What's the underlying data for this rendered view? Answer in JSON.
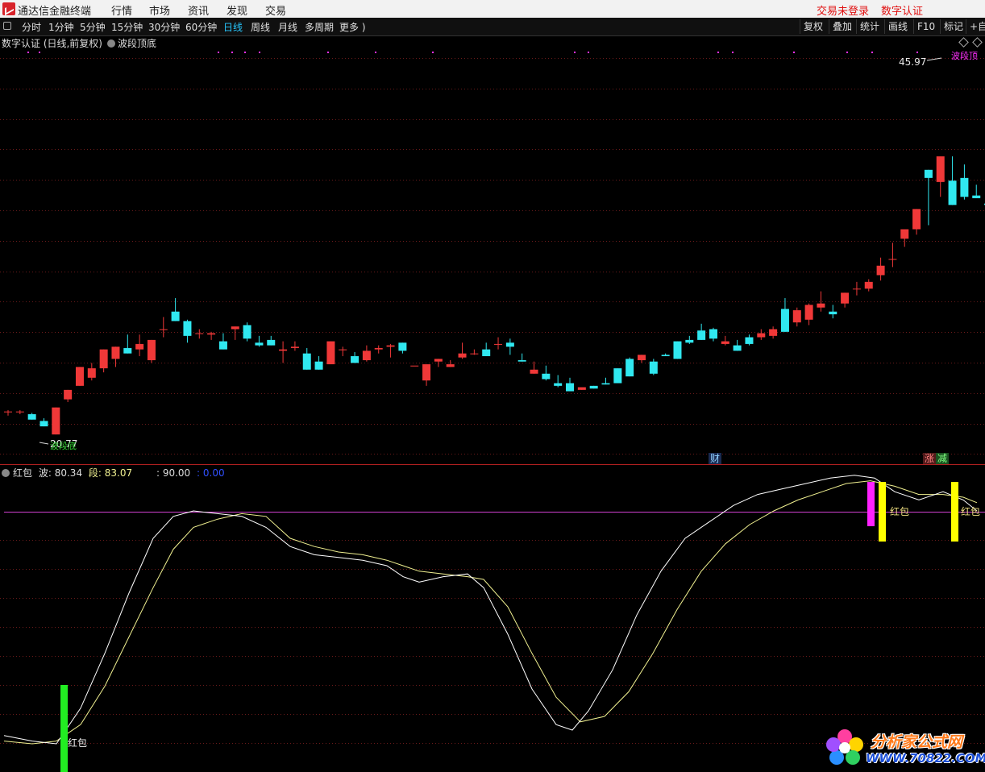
{
  "titlebar": {
    "app_name": "通达信金融终端",
    "menus": [
      "行情",
      "市场",
      "资讯",
      "发现",
      "交易"
    ],
    "right": [
      "交易未登录",
      "数字认证"
    ]
  },
  "toolbar": {
    "periods": [
      "分时",
      "1分钟",
      "5分钟",
      "15分钟",
      "30分钟",
      "60分钟",
      "日线",
      "周线",
      "月线",
      "多周期",
      "更多 )"
    ],
    "active": "日线",
    "right_buttons": [
      "复权",
      "叠加",
      "统计",
      "画线",
      "F10",
      "标记",
      "+自"
    ]
  },
  "main_header": {
    "title": "数字认证 (日线,前复权)",
    "indicator": "波段顶底"
  },
  "annotations": {
    "high_price": "45.97",
    "low_price": "20.77",
    "low_label": "波段底",
    "high_label": "波段顶",
    "event_cai": "财",
    "event_zhang": "涨",
    "event_jian": "减"
  },
  "sub_header": {
    "name": "红包",
    "wave_label": "波:",
    "wave_value": "80.34",
    "seg_label": "段:",
    "seg_value": "83.07",
    "level_label": ": 90.00",
    "level2": ": 0.00"
  },
  "sub_labels": {
    "red_packet_1": "红包",
    "red_packet_2": "红包",
    "red_packet_3": "红包"
  },
  "watermark": {
    "name": "分析家公式网",
    "url": "WWW.70822.COM"
  },
  "colors": {
    "up": "#f03838",
    "down": "#30e8f0",
    "wave": "#ffffff",
    "segment": "#f0f090",
    "level_line": "#d040d0",
    "bar_green": "#22ee22",
    "bar_magenta": "#ff22ff",
    "bar_yellow": "#ffff00",
    "active_tab": "#27c8ff"
  },
  "chart_data": {
    "type": "candlestick",
    "price_range": [
      18.8,
      49.6
    ],
    "candles": [
      [
        22.7,
        22.8,
        22.4,
        22.7
      ],
      [
        22.7,
        22.8,
        22.5,
        22.7
      ],
      [
        22.5,
        22.6,
        22.1,
        22.1
      ],
      [
        22.0,
        22.2,
        21.6,
        21.6
      ],
      [
        21.0,
        23.0,
        21.0,
        23.0
      ],
      [
        23.6,
        24.3,
        23.4,
        24.3
      ],
      [
        24.6,
        26.0,
        24.6,
        26.0
      ],
      [
        25.2,
        26.3,
        25.0,
        25.9
      ],
      [
        25.9,
        27.3,
        25.6,
        27.3
      ],
      [
        26.6,
        27.5,
        26.0,
        27.5
      ],
      [
        27.4,
        28.4,
        27.0,
        27.0
      ],
      [
        27.3,
        28.4,
        26.8,
        27.7
      ],
      [
        26.5,
        28.0,
        26.3,
        28.0
      ],
      [
        28.8,
        29.7,
        28.2,
        28.8
      ],
      [
        30.1,
        31.1,
        29.4,
        29.4
      ],
      [
        29.4,
        29.5,
        27.8,
        28.3
      ],
      [
        28.5,
        28.8,
        28.1,
        28.5
      ],
      [
        28.4,
        28.6,
        28.0,
        28.5
      ],
      [
        27.9,
        28.5,
        27.3,
        27.3
      ],
      [
        28.8,
        29.0,
        28.0,
        29.0
      ],
      [
        29.1,
        29.3,
        27.9,
        28.1
      ],
      [
        27.8,
        28.3,
        27.5,
        27.6
      ],
      [
        28.0,
        28.3,
        27.6,
        27.6
      ],
      [
        27.2,
        27.9,
        26.3,
        27.3
      ],
      [
        27.4,
        27.9,
        27.2,
        27.5
      ],
      [
        27.0,
        27.4,
        25.8,
        25.8
      ],
      [
        26.4,
        26.8,
        25.8,
        25.8
      ],
      [
        26.2,
        27.7,
        26.2,
        27.9
      ],
      [
        27.3,
        27.5,
        26.8,
        27.3
      ],
      [
        26.8,
        27.1,
        26.3,
        26.3
      ],
      [
        26.5,
        27.6,
        26.4,
        27.2
      ],
      [
        27.3,
        27.6,
        27.0,
        27.4
      ],
      [
        27.5,
        27.7,
        26.7,
        27.6
      ],
      [
        27.8,
        27.8,
        27.0,
        27.2
      ],
      [
        26.1,
        26.1,
        26.2,
        26.1
      ],
      [
        25.0,
        26.2,
        24.6,
        26.2
      ],
      [
        26.4,
        26.6,
        26.0,
        26.6
      ],
      [
        26.0,
        26.5,
        26.2,
        26.2
      ],
      [
        26.7,
        27.8,
        26.6,
        27.0
      ],
      [
        27.0,
        27.3,
        26.9,
        27.0
      ],
      [
        27.3,
        27.8,
        26.8,
        26.8
      ],
      [
        27.7,
        28.2,
        27.3,
        27.7
      ],
      [
        27.8,
        28.1,
        26.9,
        27.5
      ],
      [
        26.5,
        27.0,
        26.6,
        26.4
      ],
      [
        25.5,
        26.4,
        25.5,
        25.8
      ],
      [
        25.5,
        26.1,
        25.0,
        25.1
      ],
      [
        24.8,
        25.4,
        24.5,
        24.6
      ],
      [
        24.8,
        25.2,
        24.2,
        24.2
      ],
      [
        24.3,
        24.5,
        24.3,
        24.5
      ],
      [
        24.6,
        24.6,
        24.4,
        24.4
      ],
      [
        24.8,
        25.2,
        24.7,
        24.7
      ],
      [
        25.9,
        25.9,
        24.8,
        24.8
      ],
      [
        26.6,
        26.7,
        25.8,
        25.3
      ],
      [
        26.5,
        26.9,
        26.3,
        26.9
      ],
      [
        26.4,
        26.6,
        25.4,
        25.5
      ],
      [
        26.9,
        27.0,
        26.8,
        26.8
      ],
      [
        27.9,
        27.9,
        26.6,
        26.6
      ],
      [
        28.0,
        28.3,
        27.7,
        27.8
      ],
      [
        28.7,
        29.2,
        28.2,
        28.0
      ],
      [
        28.8,
        28.9,
        27.9,
        28.1
      ],
      [
        27.7,
        28.3,
        27.6,
        27.9
      ],
      [
        27.6,
        28.0,
        27.2,
        27.2
      ],
      [
        28.2,
        28.4,
        27.6,
        27.7
      ],
      [
        28.2,
        28.8,
        28.0,
        28.5
      ],
      [
        28.3,
        29.0,
        28.1,
        28.8
      ],
      [
        30.3,
        31.1,
        28.6,
        28.6
      ],
      [
        29.3,
        30.4,
        29.0,
        30.2
      ],
      [
        29.5,
        30.7,
        29.1,
        30.6
      ],
      [
        30.4,
        31.6,
        30.1,
        30.7
      ],
      [
        30.1,
        30.6,
        29.6,
        29.9
      ],
      [
        30.7,
        31.5,
        30.4,
        31.5
      ],
      [
        31.8,
        32.3,
        31.3,
        31.8
      ],
      [
        31.8,
        32.5,
        31.6,
        32.3
      ],
      [
        32.8,
        34.1,
        32.4,
        33.5
      ],
      [
        34.0,
        35.2,
        33.4,
        34.0
      ],
      [
        35.5,
        36.2,
        34.9,
        36.2
      ],
      [
        36.2,
        37.4,
        35.8,
        37.7
      ],
      [
        40.6,
        40.6,
        36.5,
        40.0
      ],
      [
        39.7,
        40.3,
        38.6,
        41.6
      ],
      [
        39.8,
        41.6,
        38.0,
        38.0
      ],
      [
        40.0,
        41.0,
        38.4,
        38.6
      ],
      [
        38.7,
        39.5,
        38.6,
        38.5
      ],
      [
        38.1,
        39.4,
        38.3,
        38.0
      ],
      [
        39.0,
        39.5,
        38.6,
        38.6
      ],
      [
        39.2,
        41.3,
        38.3,
        41.4
      ],
      [
        44.5,
        46.0,
        42.7,
        43.7
      ],
      [
        43.6,
        43.8,
        41.9,
        41.3
      ],
      [
        40.9,
        41.6,
        40.0,
        39.4
      ],
      [
        41.9,
        42.4,
        40.8,
        40.6
      ]
    ]
  }
}
